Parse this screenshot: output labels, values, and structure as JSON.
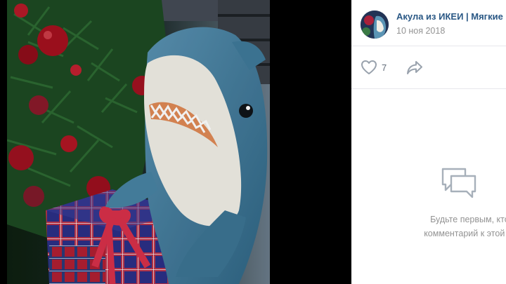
{
  "post": {
    "author_name": "Акула из ИКЕИ | Мягкие и",
    "date": "10 ноя 2018",
    "likes_count": "7"
  },
  "comments": {
    "empty_line1": "Будьте первым, кто оста",
    "empty_line2": "комментарий к этой фотогр"
  },
  "photo": {
    "description_subject": "plush shark beside Christmas tree and gifts"
  },
  "colors": {
    "link": "#2a5885",
    "muted": "#939393",
    "icon": "#99a2ad"
  },
  "icons": [
    "heart-icon",
    "share-icon",
    "comments-icon"
  ]
}
